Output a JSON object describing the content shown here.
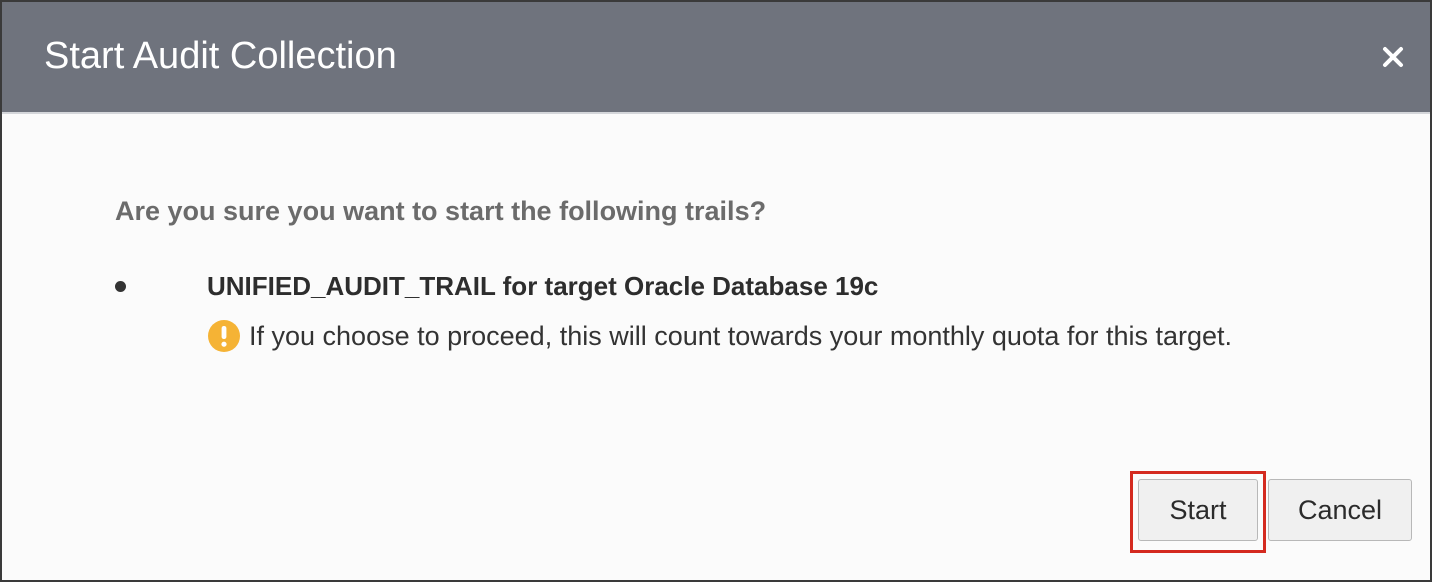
{
  "dialog": {
    "title": "Start Audit Collection",
    "close_icon": "close-icon",
    "question": "Are you sure you want to start the following trails?",
    "trails": [
      {
        "name": "UNIFIED_AUDIT_TRAIL for target Oracle Database 19c",
        "warning_icon": "warning-icon",
        "warning": "If you choose to proceed, this will count towards your monthly quota for this target."
      }
    ],
    "buttons": {
      "start_label": "Start",
      "cancel_label": "Cancel"
    }
  },
  "colors": {
    "header_bg": "#6f737d",
    "dialog_bg": "#fbfbfb",
    "warning": "#f5b335",
    "highlight_border": "#d42a1f"
  }
}
